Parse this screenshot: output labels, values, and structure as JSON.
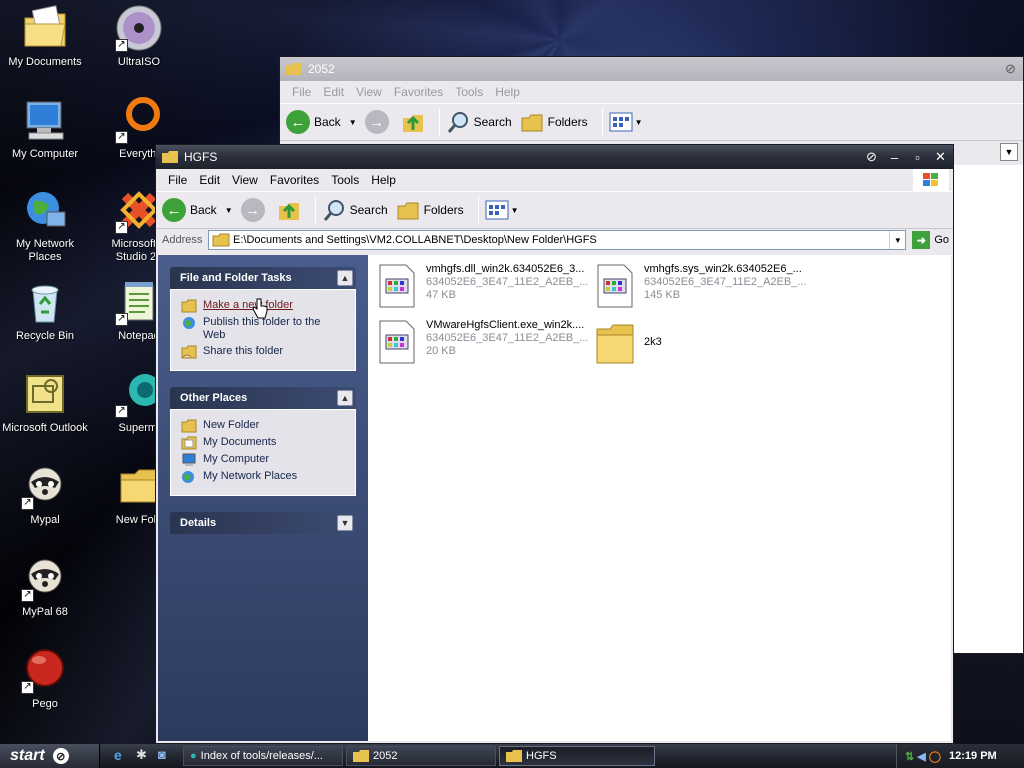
{
  "desktop_icons": [
    {
      "label": "My Documents",
      "icon": "my-documents-icon"
    },
    {
      "label": "UltraISO",
      "icon": "disc-icon"
    },
    {
      "label": "My Computer",
      "icon": "computer-icon"
    },
    {
      "label": "Everythi",
      "icon": "search-ring-icon"
    },
    {
      "label": "My Network Places",
      "icon": "network-icon"
    },
    {
      "label": "Microsoft V Studio 20",
      "icon": "visual-studio-icon"
    },
    {
      "label": "Recycle Bin",
      "icon": "recycle-bin-icon"
    },
    {
      "label": "Notepad",
      "icon": "notepad-icon"
    },
    {
      "label": "Microsoft Outlook",
      "icon": "outlook-icon"
    },
    {
      "label": "Supermi",
      "icon": "globe-icon"
    },
    {
      "label": "Mypal",
      "icon": "raccoon-icon"
    },
    {
      "label": "New Fold",
      "icon": "folder-icon"
    },
    {
      "label": "MyPal 68",
      "icon": "raccoon-icon"
    },
    {
      "label": "Pego",
      "icon": "red-ball-icon"
    }
  ],
  "back_window": {
    "title": "2052",
    "menu": [
      "File",
      "Edit",
      "View",
      "Favorites",
      "Tools",
      "Help"
    ],
    "toolbar": {
      "back": "Back",
      "search": "Search",
      "folders": "Folders"
    }
  },
  "window": {
    "title": "HGFS",
    "menu": [
      "File",
      "Edit",
      "View",
      "Favorites",
      "Tools",
      "Help"
    ],
    "toolbar": {
      "back": "Back",
      "search": "Search",
      "folders": "Folders"
    },
    "address": {
      "label": "Address",
      "value": "E:\\Documents and Settings\\VM2.COLLABNET\\Desktop\\New Folder\\HGFS",
      "go": "Go"
    },
    "sidebar": {
      "file_tasks": {
        "title": "File and Folder Tasks",
        "items": [
          "Make a new folder",
          "Publish this folder to the Web",
          "Share this folder"
        ]
      },
      "other_places": {
        "title": "Other Places",
        "items": [
          "New Folder",
          "My Documents",
          "My Computer",
          "My Network Places"
        ]
      },
      "details": {
        "title": "Details"
      }
    },
    "files": [
      {
        "name": "vmhgfs.dll_win2k.634052E6_3...",
        "meta": "634052E6_3E47_11E2_A2EB_...",
        "size": "47 KB",
        "type": "file"
      },
      {
        "name": "vmhgfs.sys_win2k.634052E6_...",
        "meta": "634052E6_3E47_11E2_A2EB_...",
        "size": "145 KB",
        "type": "file"
      },
      {
        "name": "VMwareHgfsClient.exe_win2k....",
        "meta": "634052E6_3E47_11E2_A2EB_...",
        "size": "20 KB",
        "type": "file"
      },
      {
        "name": "2k3",
        "meta": "",
        "size": "",
        "type": "folder"
      }
    ]
  },
  "taskbar": {
    "start": "start",
    "items": [
      "Index of tools/releases/...",
      "2052",
      "HGFS"
    ],
    "active": "HGFS",
    "clock": "12:19 PM"
  },
  "colors": {
    "accent": "#3b4d78",
    "folder": "#f2d36a"
  }
}
